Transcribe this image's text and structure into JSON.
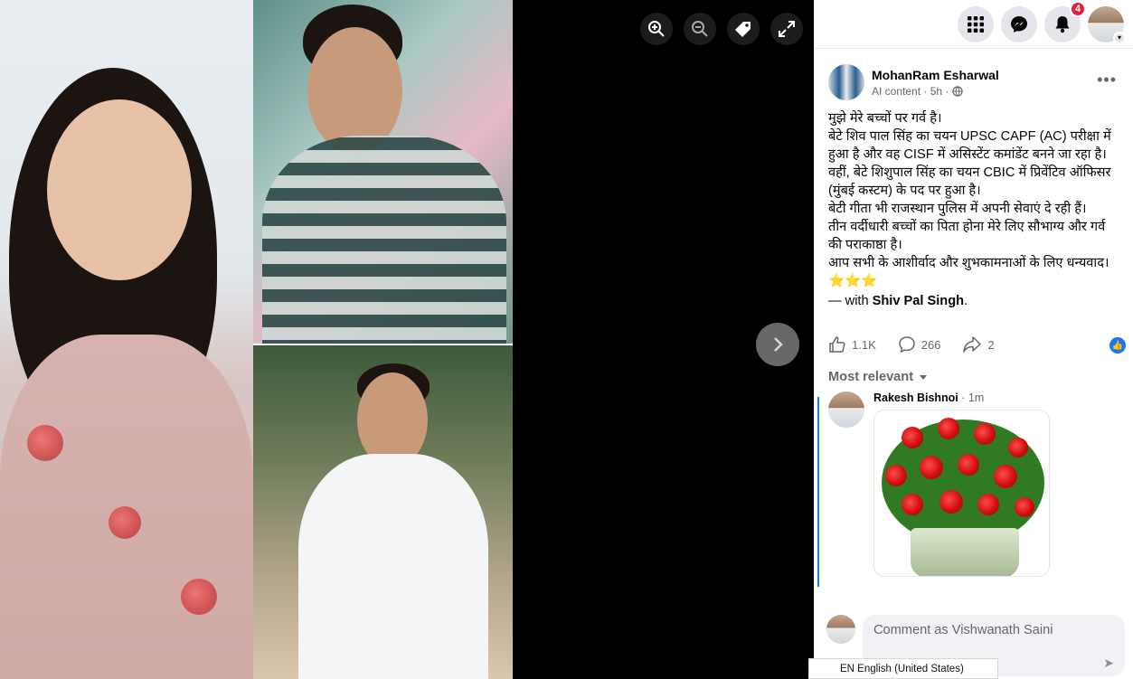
{
  "viewer": {
    "zoom_in_icon": "zoom-in-icon",
    "zoom_out_icon": "zoom-out-icon",
    "tag_icon": "tag-icon",
    "fullscreen_icon": "fullscreen-icon",
    "next_icon": "chevron-right-icon"
  },
  "topbar": {
    "menu_icon": "grid-icon",
    "messenger_icon": "messenger-icon",
    "notifications_icon": "bell-icon",
    "notifications_count": "4"
  },
  "post": {
    "author": "MohanRam Esharwal",
    "meta": "AI content · 5h · ",
    "lines": [
      "मुझे मेरे बच्चों पर गर्व है।",
      "बेटे शिव पाल सिंह का चयन UPSC CAPF (AC) परीक्षा में हुआ है और वह CISF में असिस्टेंट कमांडेंट बनने जा रहा है।",
      "वहीं, बेटे शिशुपाल सिंह का चयन CBIC में प्रिवेंटिव ऑफिसर (मुंबई कस्टम) के पद पर हुआ है।",
      "बेटी गीता भी राजस्थान पुलिस में अपनी सेवाएं दे रही हैं।",
      "तीन वर्दीधारी बच्चों का पिता होना मेरे लिए सौभाग्य और गर्व की पराकाष्ठा है।",
      "आप सभी के आशीर्वाद और शुभकामनाओं के लिए धन्यवाद।⭐⭐⭐"
    ],
    "with_prefix": "— with ",
    "with_name": "Shiv Pal Singh",
    "with_suffix": ".",
    "likes": "1.1K",
    "comments": "266",
    "shares": "2"
  },
  "comments": {
    "sort_label": "Most relevant",
    "items": [
      {
        "name": "Rakesh Bishnoi",
        "time": "1m"
      }
    ],
    "composer_placeholder": "Comment as Vishwanath Saini"
  },
  "status": {
    "language": "EN English (United States)"
  },
  "colors": {
    "accent": "#1877f2",
    "badge": "#e41e3f"
  }
}
